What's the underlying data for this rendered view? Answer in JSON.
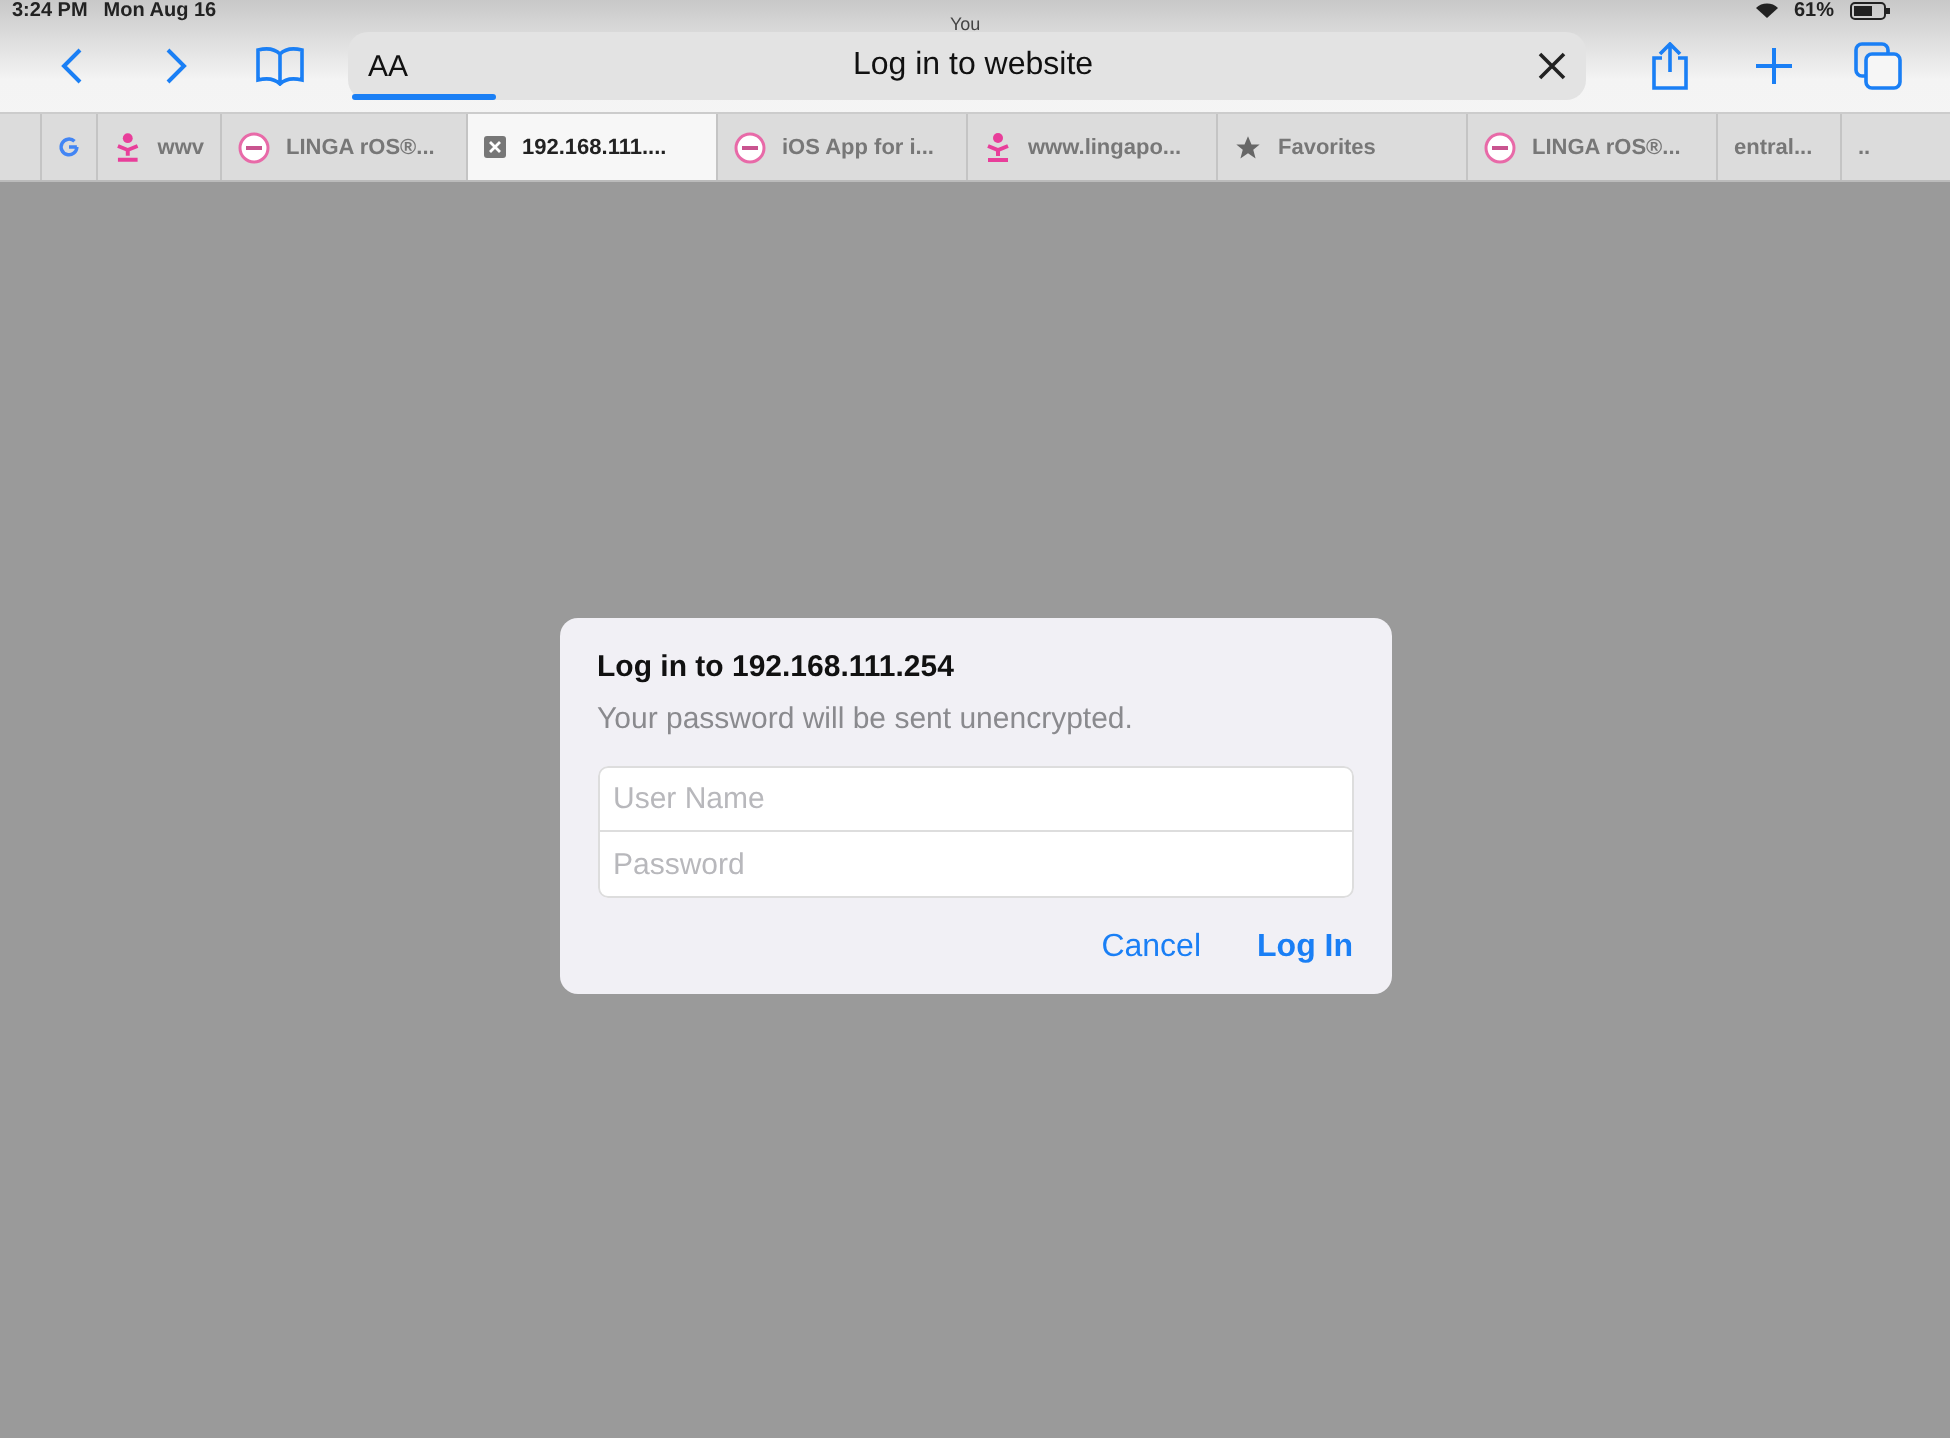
{
  "status_bar": {
    "time": "3:24 PM",
    "date": "Mon Aug 16",
    "battery": "61%"
  },
  "shared_by": "You",
  "toolbar": {
    "reader_label": "AA",
    "page_title": "Log in to website",
    "loading": true
  },
  "tabs": [
    {
      "selected": false
    },
    {
      "label": "wwv",
      "selected": false
    },
    {
      "label": "LINGA rOS®...",
      "selected": false
    },
    {
      "label": "192.168.111....",
      "selected": true
    },
    {
      "label": "iOS App for i...",
      "selected": false
    },
    {
      "label": "www.lingapo...",
      "selected": false
    },
    {
      "label": "Favorites",
      "selected": false
    },
    {
      "label": "LINGA rOS®...",
      "selected": false
    },
    {
      "label": "entral...",
      "selected": false
    },
    {
      "label": "..",
      "selected": false
    }
  ],
  "dialog": {
    "title": "Log in to 192.168.111.254",
    "message": "Your password will be sent unencrypted.",
    "fields": [
      {
        "placeholder": "User Name"
      },
      {
        "placeholder": "Password"
      }
    ],
    "buttons": [
      {
        "label": "Cancel",
        "kind": "secondary"
      },
      {
        "label": "Log In",
        "kind": "primary"
      }
    ]
  }
}
